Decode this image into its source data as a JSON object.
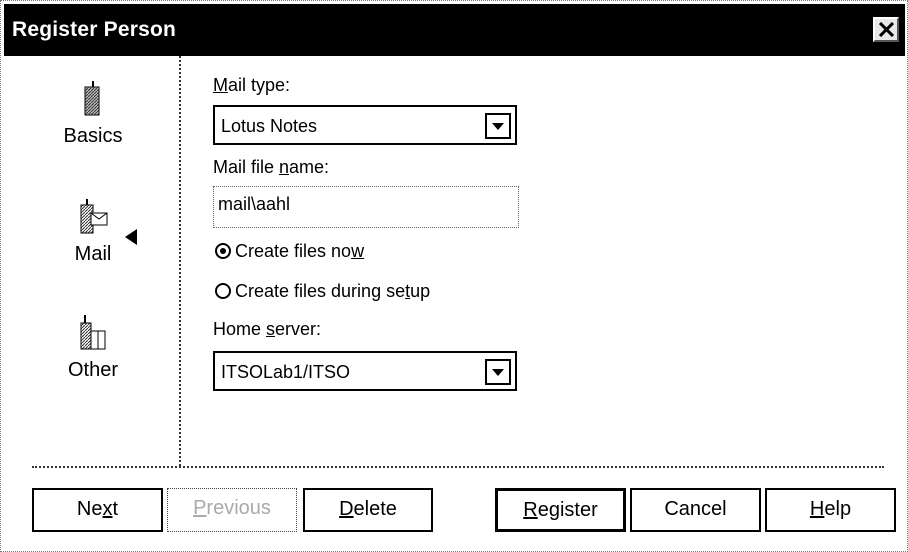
{
  "window": {
    "title": "Register Person"
  },
  "sidebar": {
    "items": [
      {
        "label": "Basics",
        "icon": "basics-icon"
      },
      {
        "label": "Mail",
        "icon": "mail-icon",
        "selected": true
      },
      {
        "label": "Other",
        "icon": "other-icon"
      }
    ]
  },
  "form": {
    "mail_type": {
      "label_u": "M",
      "label_rest": "ail type:",
      "value": "Lotus Notes"
    },
    "mail_file": {
      "label_pre": "Mail file ",
      "label_u": "n",
      "label_rest": "ame:",
      "value": "mail\\aahl"
    },
    "radio_now": {
      "label_pre": "Create files no",
      "label_u": "w",
      "label_rest": "",
      "checked": true
    },
    "radio_setup": {
      "label_pre": "Create files during se",
      "label_u": "t",
      "label_rest": "up",
      "checked": false
    },
    "home_server": {
      "label_pre": "Home ",
      "label_u": "s",
      "label_rest": "erver:",
      "value": "ITSOLab1/ITSO"
    }
  },
  "buttons": {
    "next": {
      "pre": "Ne",
      "u": "x",
      "rest": "t"
    },
    "previous": {
      "pre": "",
      "u": "P",
      "rest": "revious"
    },
    "delete": {
      "pre": "",
      "u": "D",
      "rest": "elete"
    },
    "register": {
      "pre": "",
      "u": "R",
      "rest": "egister"
    },
    "cancel": {
      "pre": "Cancel",
      "u": "",
      "rest": ""
    },
    "help": {
      "pre": "",
      "u": "H",
      "rest": "elp"
    }
  }
}
